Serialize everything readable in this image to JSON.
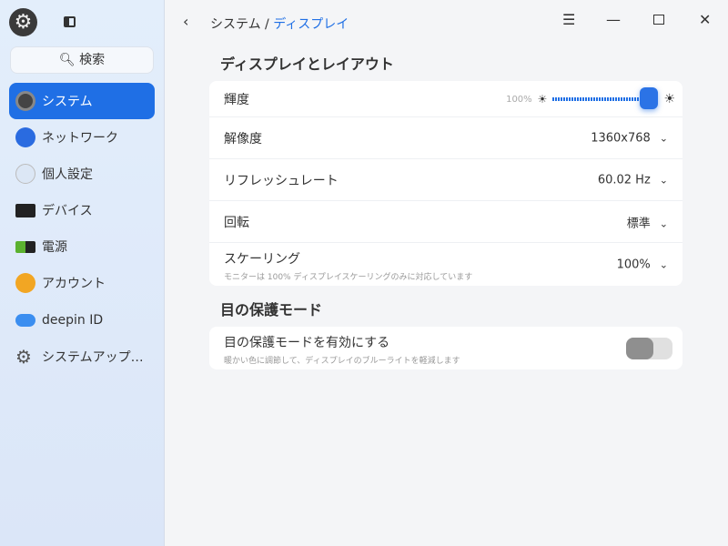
{
  "sidebar": {
    "search": "検索",
    "items": [
      {
        "label": "システム",
        "icon": "system-icon"
      },
      {
        "label": "ネットワーク",
        "icon": "network-icon"
      },
      {
        "label": "個人設定",
        "icon": "personalization-icon"
      },
      {
        "label": "デバイス",
        "icon": "devices-icon"
      },
      {
        "label": "電源",
        "icon": "power-icon"
      },
      {
        "label": "アカウント",
        "icon": "account-icon"
      },
      {
        "label": "deepin ID",
        "icon": "cloud-icon"
      },
      {
        "label": "システムアップ…",
        "icon": "update-icon"
      }
    ]
  },
  "header": {
    "crumb_parent": "システム",
    "sep": "/",
    "crumb_current": "ディスプレイ"
  },
  "display": {
    "title": "ディスプレイとレイアウト",
    "brightness": {
      "label": "輝度",
      "value_text": "100%",
      "value": 100
    },
    "resolution": {
      "label": "解像度",
      "value": "1360x768"
    },
    "refresh": {
      "label": "リフレッシュレート",
      "value": "60.02 Hz"
    },
    "rotation": {
      "label": "回転",
      "value": "標準"
    },
    "scaling": {
      "label": "スケーリング",
      "desc": "モニターは 100% ディスプレイスケーリングのみに対応しています",
      "value": "100%"
    }
  },
  "eye": {
    "title": "目の保護モード",
    "enable_label": "目の保護モードを有効にする",
    "enable_desc": "暖かい色に調節して、ディスプレイのブルーライトを軽減します",
    "enabled": false
  },
  "colors": {
    "accent": "#1f6fe5"
  }
}
